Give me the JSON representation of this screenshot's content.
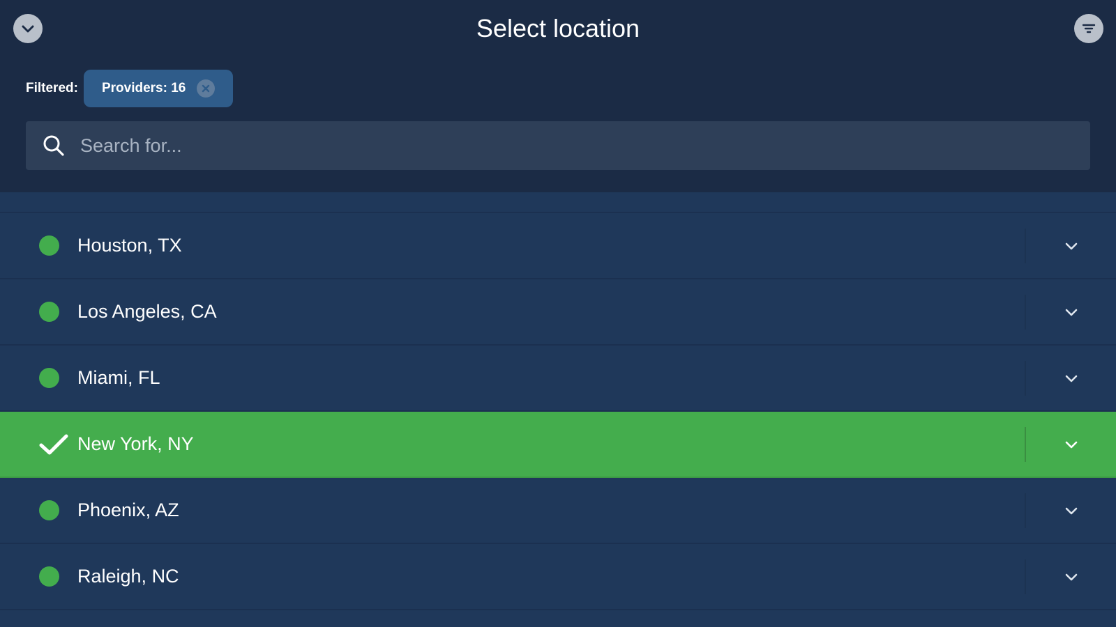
{
  "header": {
    "title": "Select location",
    "collapse_icon": "chevron-down-icon",
    "filter_icon": "filter-icon"
  },
  "filter": {
    "label": "Filtered:",
    "chip_label": "Providers: 16",
    "chip_clear_icon": "close-icon"
  },
  "search": {
    "placeholder": "Search for...",
    "value": "",
    "icon": "search-icon"
  },
  "locations": [
    {
      "label": "Houston, TX",
      "status": "online",
      "selected": false
    },
    {
      "label": "Los Angeles, CA",
      "status": "online",
      "selected": false
    },
    {
      "label": "Miami, FL",
      "status": "online",
      "selected": false
    },
    {
      "label": "New York, NY",
      "status": "online",
      "selected": true
    },
    {
      "label": "Phoenix, AZ",
      "status": "online",
      "selected": false
    },
    {
      "label": "Raleigh, NC",
      "status": "online",
      "selected": false
    }
  ],
  "colors": {
    "background": "#1b2b45",
    "list_background": "#1f385a",
    "accent_green": "#44ad4d",
    "chip_background": "#2f5c8a",
    "search_background": "#2e3f58"
  }
}
